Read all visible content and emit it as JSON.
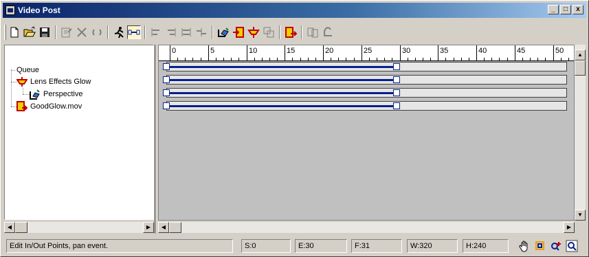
{
  "window": {
    "title": "Video Post"
  },
  "title_buttons": {
    "minimize": "_",
    "maximize": "□",
    "close": "x"
  },
  "toolbar": {
    "tools": [
      {
        "name": "new-sequence-icon",
        "active": false
      },
      {
        "name": "open-sequence-icon",
        "active": false
      },
      {
        "name": "save-sequence-icon",
        "active": false
      },
      {
        "name": "edit-current-event-icon",
        "active": false
      },
      {
        "name": "delete-current-event-icon",
        "active": false
      },
      {
        "name": "swap-events-icon",
        "active": false
      },
      {
        "name": "execute-sequence-icon",
        "active": false
      },
      {
        "name": "edit-range-bar-icon",
        "active": true
      },
      {
        "name": "align-left-icon",
        "active": false
      },
      {
        "name": "align-right-icon",
        "active": false
      },
      {
        "name": "make-same-size-icon",
        "active": false
      },
      {
        "name": "abut-selected-icon",
        "active": false
      },
      {
        "name": "add-scene-event-icon",
        "active": false
      },
      {
        "name": "add-image-input-event-icon",
        "active": false
      },
      {
        "name": "add-image-filter-event-icon",
        "active": false
      },
      {
        "name": "add-image-layer-event-icon",
        "active": false
      },
      {
        "name": "add-image-output-event-icon",
        "active": false
      },
      {
        "name": "add-external-event-icon",
        "active": false
      },
      {
        "name": "add-loop-event-icon",
        "active": false
      }
    ]
  },
  "queue": {
    "root": "Queue",
    "items": [
      {
        "label": "Lens Effects Glow",
        "icon": "image-filter-event-icon",
        "level": 1
      },
      {
        "label": "Perspective",
        "icon": "scene-event-icon",
        "level": 2
      },
      {
        "label": "GoodGlow.mov",
        "icon": "image-output-event-icon",
        "level": 1
      }
    ]
  },
  "ruler": {
    "labels": [
      "0",
      "5",
      "10",
      "15",
      "20",
      "25",
      "30",
      "35",
      "40",
      "45",
      "50"
    ]
  },
  "tracks": [
    {
      "start": 0,
      "end": 30
    },
    {
      "start": 0,
      "end": 30
    },
    {
      "start": 0,
      "end": 30
    },
    {
      "start": 0,
      "end": 30
    }
  ],
  "status": {
    "message": "Edit In/Out Points, pan event.",
    "start": "S:0",
    "end": "E:30",
    "frames": "F:31",
    "width": "W:320",
    "height": "H:240"
  },
  "colors": {
    "range_bar": "#08208c",
    "title_start": "#0a246a",
    "title_end": "#a6caf0"
  }
}
